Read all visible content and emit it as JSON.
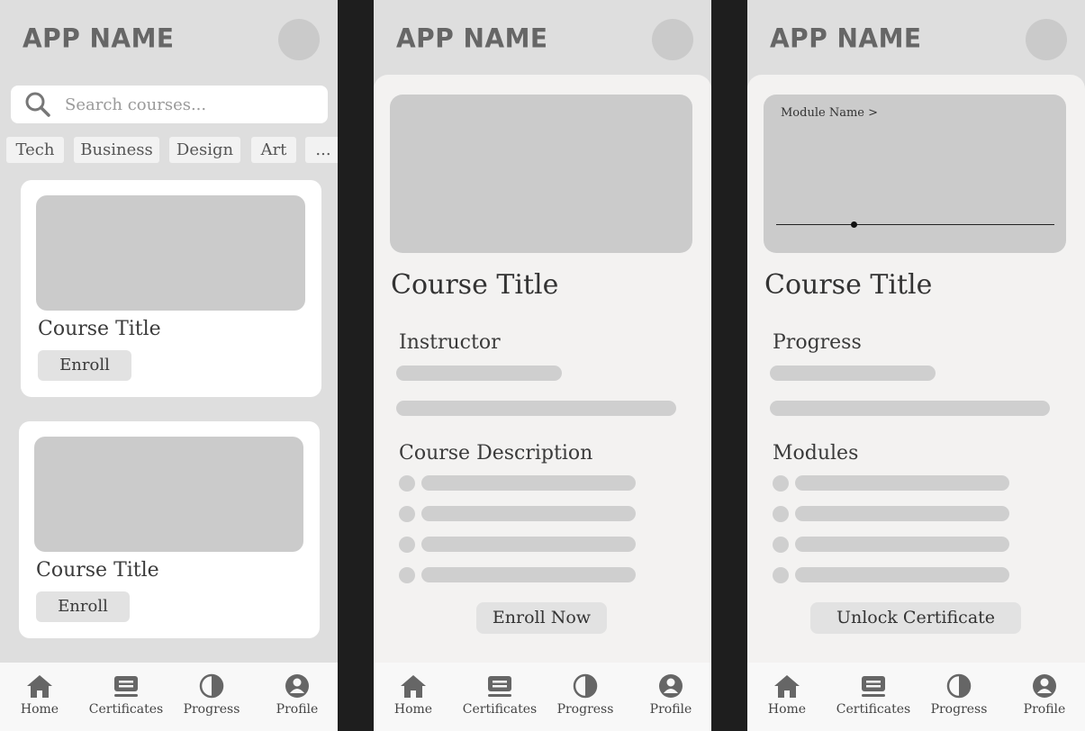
{
  "app": {
    "name": "APP NAME"
  },
  "search": {
    "placeholder": "Search courses..."
  },
  "categories": [
    "Tech",
    "Business",
    "Design",
    "Art",
    "..."
  ],
  "course_list": [
    {
      "title": "Course Title",
      "button": "Enroll"
    },
    {
      "title": "Course Title",
      "button": "Enroll"
    }
  ],
  "course_detail": {
    "title": "Course Title",
    "instructor_label": "Instructor",
    "description_label": "Course Description",
    "cta": "Enroll Now"
  },
  "course_progress": {
    "module_label": "Module Name >",
    "playback_position": 0.28,
    "title": "Course Title",
    "progress_label": "Progress",
    "modules_label": "Modules",
    "cta": "Unlock Certificate"
  },
  "nav": {
    "items": [
      {
        "label": "Home",
        "icon": "home-icon"
      },
      {
        "label": "Certificates",
        "icon": "certificate-icon"
      },
      {
        "label": "Progress",
        "icon": "progress-icon"
      },
      {
        "label": "Profile",
        "icon": "profile-icon"
      }
    ]
  },
  "colors": {
    "screen_bg": "#dedede",
    "panel_bg": "#f3f2f1",
    "placeholder": "#cbcbcb",
    "divider": "#1e1e1e"
  }
}
